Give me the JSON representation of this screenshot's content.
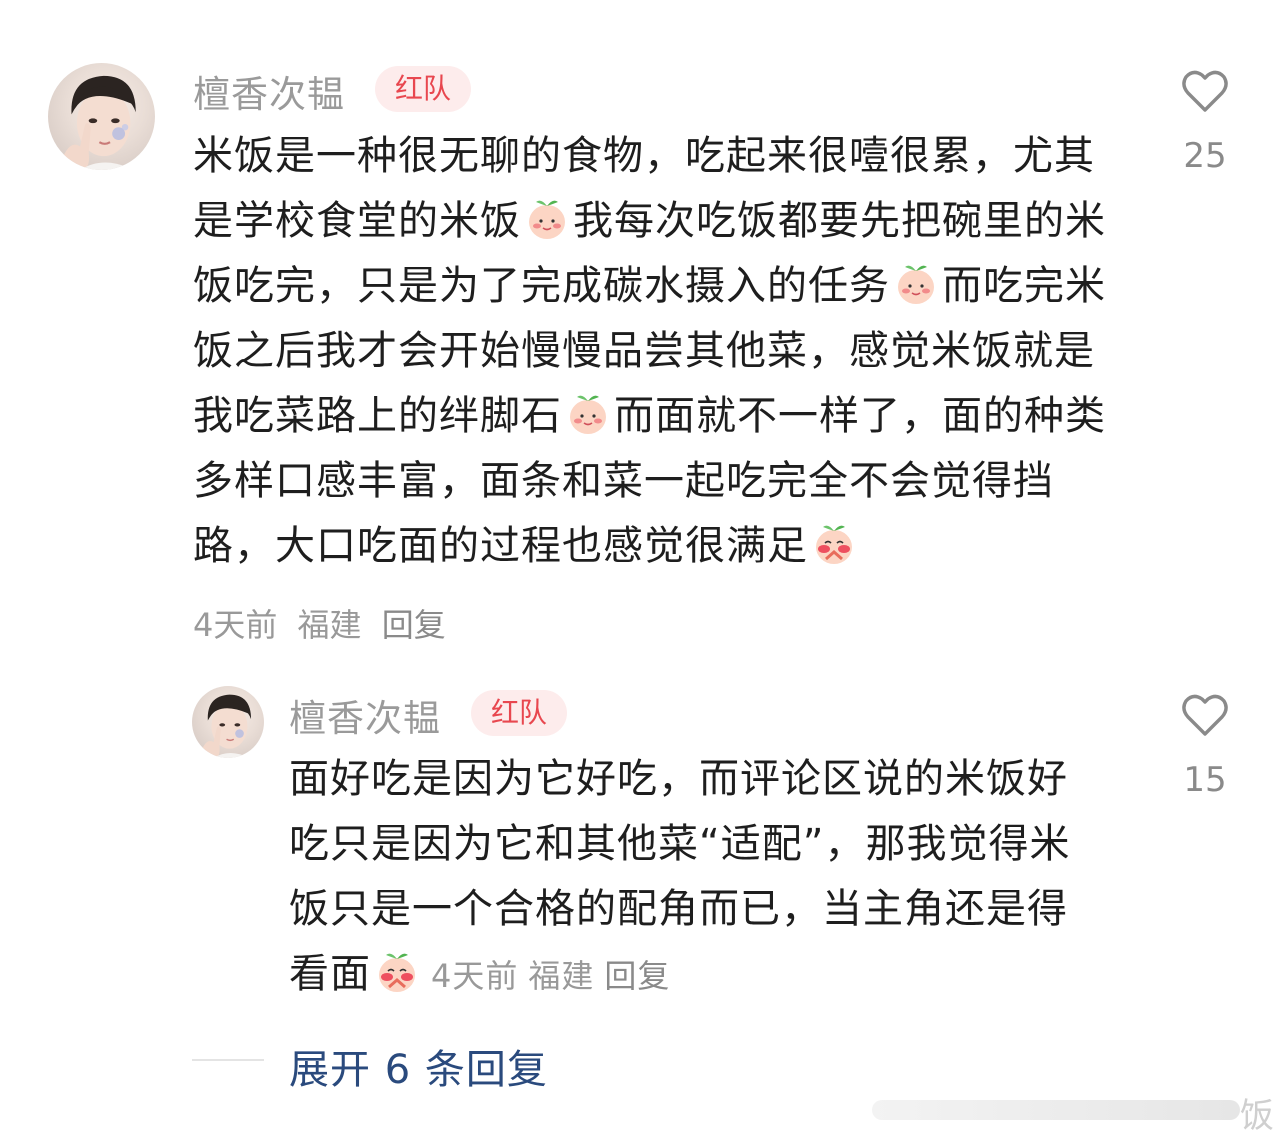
{
  "comment": {
    "username": "檀香次韫",
    "badge": "红队",
    "text_parts": [
      "米饭是一种很无聊的食物，吃起来很噎很累，尤其是学校食堂的米饭",
      "我每次吃饭都要先把碗里的米饭吃完，只是为了完成碳水摄入的任务",
      "而吃完米饭之后我才会开始慢慢品尝其他菜，感觉米饭就是我吃菜路上的绊脚石",
      "而面就不一样了，面的种类多样口感丰富，面条和菜一起吃完全不会觉得挡路，大口吃面的过程也感觉很满足"
    ],
    "time": "4天前",
    "location": "福建",
    "reply_label": "回复",
    "like_count": "25",
    "like_icon": "heart-outline-icon"
  },
  "reply": {
    "username": "檀香次韫",
    "badge": "红队",
    "text": "面好吃是因为它好吃，而评论区说的米饭好吃只是因为它和其他菜“适配”，那我觉得米饭只是一个合格的配角而已，当主角还是得看面",
    "time": "4天前",
    "location": "福建",
    "reply_label": "回复",
    "like_count": "15",
    "like_icon": "heart-outline-icon"
  },
  "expand_replies": "展开 6 条回复",
  "watermark": "饭",
  "colors": {
    "badge_text": "#e8474f",
    "badge_bg": "#fdecec",
    "expand_link": "#2a4a7d",
    "meta": "#999999"
  }
}
